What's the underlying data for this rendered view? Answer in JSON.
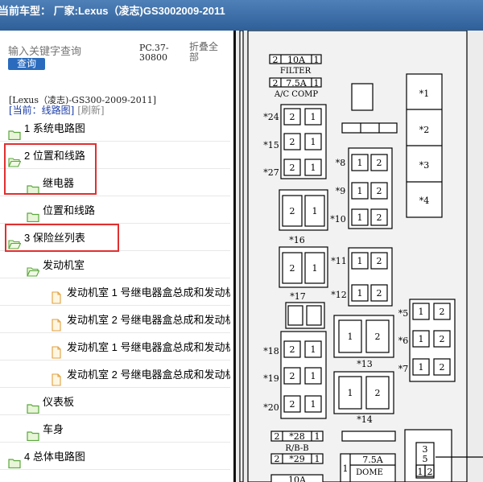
{
  "header": {
    "title": "当前车型：  厂家:Lexus（凌志)GS3002009-2011"
  },
  "search": {
    "placeholder": "输入关键字查询",
    "button": "查询"
  },
  "pc_code": "PC.37-30800",
  "collapse_all": "折叠全部",
  "model_line": "[Lexus（凌志)-GS300-2009-2011]",
  "current": {
    "label": "[当前：线路图]",
    "refresh": "[刷新]"
  },
  "tree": [
    {
      "label": "1 系统电路图",
      "icon": "folder-closed-icon"
    },
    {
      "label": "2 位置和线路",
      "icon": "folder-open-icon"
    },
    {
      "label": "继电器",
      "icon": "folder-closed-icon"
    },
    {
      "label": "位置和线路",
      "icon": "folder-closed-icon"
    },
    {
      "label": "3 保险丝列表",
      "icon": "folder-open-icon"
    },
    {
      "label": "发动机室",
      "icon": "folder-open-icon"
    },
    {
      "label": "发动机室 1 号继电器盒总成和发动机",
      "icon": "page-icon"
    },
    {
      "label": "发动机室 2 号继电器盒总成和发动机",
      "icon": "page-icon"
    },
    {
      "label": "发动机室 1 号继电器盒总成和发动机",
      "icon": "page-icon"
    },
    {
      "label": "发动机室 2 号继电器盒总成和发动机",
      "icon": "page-icon"
    },
    {
      "label": "仪表板",
      "icon": "folder-closed-icon"
    },
    {
      "label": "车身",
      "icon": "folder-closed-icon"
    },
    {
      "label": "4 总体电路图",
      "icon": "folder-closed-icon"
    }
  ],
  "diagram": {
    "fuse_labels": [
      "2",
      "10A",
      "1",
      "FILTER",
      "2",
      "7.5A",
      "1",
      "A/C COMP",
      "*28",
      "R/B-B",
      "*29",
      "7.5A",
      "DOME",
      "10A",
      "1"
    ],
    "relay_labels": [
      "*24",
      "*15",
      "*27",
      "*16",
      "*17",
      "*18",
      "*19",
      "*20",
      "*8",
      "*9",
      "*10",
      "*11",
      "*12",
      "*13",
      "*14",
      "*5",
      "*6",
      "*7",
      "*1",
      "*2",
      "*3",
      "*4"
    ],
    "pins": [
      "1",
      "2",
      "3",
      "5"
    ]
  }
}
